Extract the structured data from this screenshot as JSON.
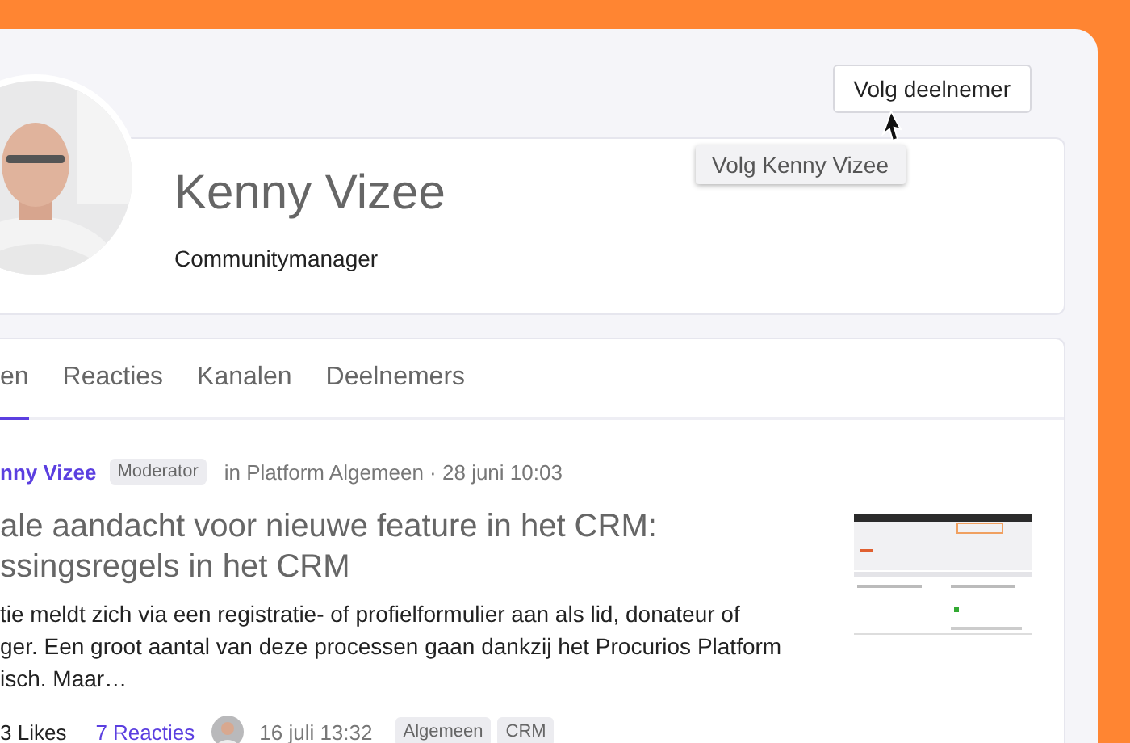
{
  "header": {
    "follow_button": "Volg deelnemer",
    "tooltip": "Volg Kenny Vizee"
  },
  "profile": {
    "name": "Kenny Vizee",
    "role": "Communitymanager"
  },
  "tabs": [
    {
      "label": "en",
      "selected": true
    },
    {
      "label": "Reacties",
      "selected": false
    },
    {
      "label": "Kanalen",
      "selected": false
    },
    {
      "label": "Deelnemers",
      "selected": false
    }
  ],
  "post": {
    "author": "nny Vizee",
    "badge": "Moderator",
    "meta": "in Platform Algemeen · 28 juni 10:03",
    "title_lines": [
      "ale aandacht voor nieuwe feature in het CRM:",
      "ssingsregels in het CRM"
    ],
    "body_lines": [
      "tie meldt zich via een registratie- of profielformulier aan als lid, donateur of",
      "ger. Een groot aantal van deze processen gaan dankzij het Procurios Platform",
      "isch. Maar…"
    ],
    "likes": "3 Likes",
    "comments": "7 Reacties",
    "date": "16 juli 13:32",
    "tags": [
      "Algemeen",
      "CRM"
    ]
  }
}
